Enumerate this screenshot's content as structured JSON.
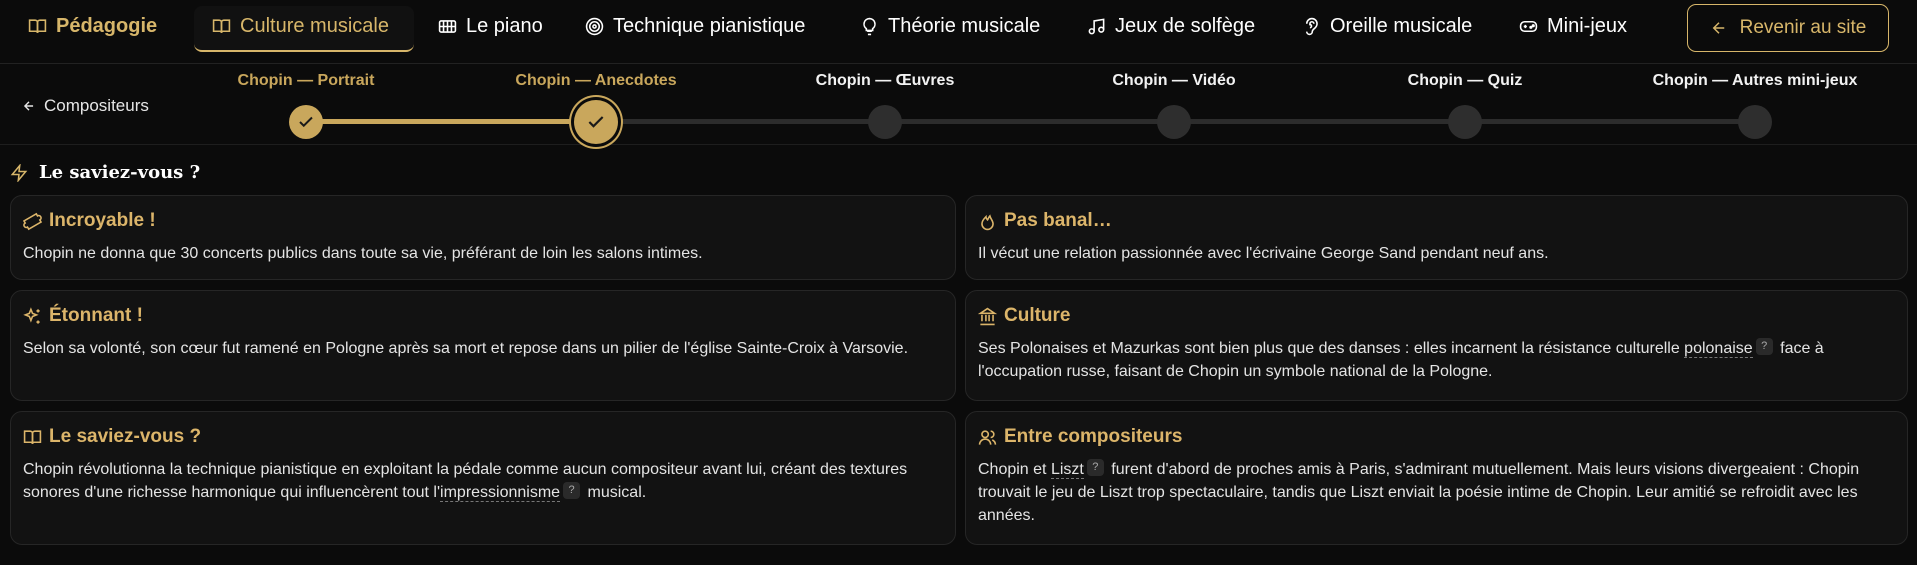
{
  "nav": {
    "brand": "Pédagogie",
    "items": [
      {
        "label": "Culture musicale",
        "icon": "book-open-icon"
      },
      {
        "label": "Le piano",
        "icon": "piano-icon"
      },
      {
        "label": "Technique pianistique",
        "icon": "target-icon"
      },
      {
        "label": "Théorie musicale",
        "icon": "lightbulb-icon"
      },
      {
        "label": "Jeux de solfège",
        "icon": "music-note-icon"
      },
      {
        "label": "Oreille musicale",
        "icon": "ear-icon"
      },
      {
        "label": "Mini-jeux",
        "icon": "gamepad-icon"
      }
    ],
    "active": "Culture musicale",
    "back_label": "Revenir au site"
  },
  "stepper": {
    "crumb": "Compositeurs",
    "steps": [
      {
        "label": "Chopin — Portrait",
        "state": "done"
      },
      {
        "label": "Chopin — Anecdotes",
        "state": "current"
      },
      {
        "label": "Chopin — Œuvres",
        "state": "todo"
      },
      {
        "label": "Chopin — Vidéo",
        "state": "todo"
      },
      {
        "label": "Chopin — Quiz",
        "state": "todo"
      },
      {
        "label": "Chopin — Autres mini-jeux",
        "state": "todo"
      }
    ]
  },
  "section": {
    "title": "Le saviez-vous ?"
  },
  "cards": {
    "c1": {
      "title": "Incroyable !",
      "icon": "ticket-icon",
      "text": "Chopin ne donna que 30 concerts publics dans toute sa vie, préférant de loin les salons intimes."
    },
    "c2": {
      "title": "Pas banal…",
      "icon": "flame-icon",
      "text": "Il vécut une relation passionnée avec l'écrivaine George Sand pendant neuf ans."
    },
    "c3": {
      "title": "Étonnant !",
      "icon": "sparkles-icon",
      "text": "Selon sa volonté, son cœur fut ramené en Pologne après sa mort et repose dans un pilier de l'église Sainte-Croix à Varsovie."
    },
    "c4": {
      "title": "Culture",
      "icon": "landmark-icon",
      "text_a": "Ses Polonaises et Mazurkas sont bien plus que des danses : elles incarnent la résistance culturelle ",
      "term": "polonaise",
      "text_b": " face à l'occupation russe, faisant de Chopin un symbole national de la Pologne."
    },
    "c5": {
      "title": "Le saviez-vous ?",
      "icon": "book-open-icon",
      "text_a": "Chopin révolutionna la technique pianistique en exploitant la pédale comme aucun compositeur avant lui, créant des textures sonores d'une richesse harmonique qui influencèrent tout l'",
      "term": "impressionnisme",
      "text_b": " musical."
    },
    "c6": {
      "title": "Entre compositeurs",
      "icon": "users-icon",
      "text_a": "Chopin et ",
      "term": "Liszt",
      "text_b": " furent d'abord de proches amis à Paris, s'admirant mutuellement. Mais leurs visions divergeaient : Chopin trouvait le jeu de Liszt trop spectaculaire, tandis que Liszt enviait la poésie intime de Chopin. Leur amitié se refroidit avec les années."
    }
  },
  "help_glyph": "?",
  "colors": {
    "accent": "#d7b66a",
    "background": "#0b0b0b",
    "card": "#121212"
  }
}
